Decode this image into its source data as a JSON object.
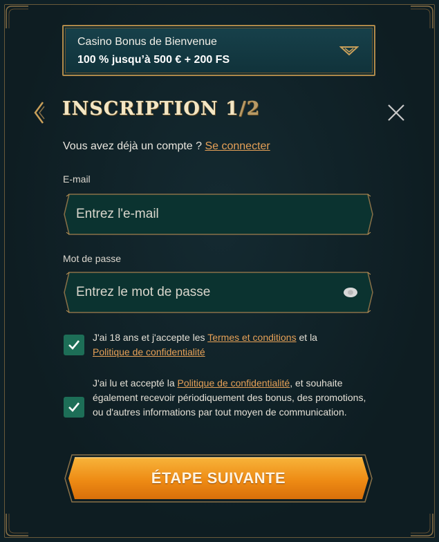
{
  "bonus": {
    "title": "Casino Bonus de Bienvenue",
    "offer": "100 % jusqu’à 500 € + 200 FS",
    "chevron_icon": "chevron-down-icon"
  },
  "header": {
    "title": "INSCRIPTION 1",
    "step_suffix": "/2",
    "back_icon": "chevron-left-icon",
    "close_icon": "close-icon"
  },
  "login_prompt": {
    "text": "Vous avez déjà un compte ? ",
    "link": "Se connecter"
  },
  "email": {
    "label": "E-mail",
    "placeholder": "Entrez l'e-mail",
    "value": ""
  },
  "password": {
    "label": "Mot de passe",
    "placeholder": "Entrez le mot de passe",
    "value": "",
    "toggle_icon": "eye-icon"
  },
  "consent_age": {
    "checked": true,
    "text_before": "J'ai 18 ans et j'accepte les ",
    "terms_link": "Termes et conditions",
    "text_middle": " et la ",
    "privacy_link": "Politique de confidentialité"
  },
  "consent_marketing": {
    "checked": true,
    "text_before": "J'ai lu et accepté la ",
    "privacy_link": "Politique de confidentialité",
    "text_after": ", et souhaite également recevoir périodiquement des bonus, des promotions, ou d'autres informations par tout moyen de communication."
  },
  "next_button": {
    "label": "ÉTAPE SUIVANTE"
  },
  "colors": {
    "background": "#0f2026",
    "gold": "#b08a4a",
    "link": "#e6a157",
    "checkbox": "#1d6e57",
    "button": "#f0941c"
  }
}
